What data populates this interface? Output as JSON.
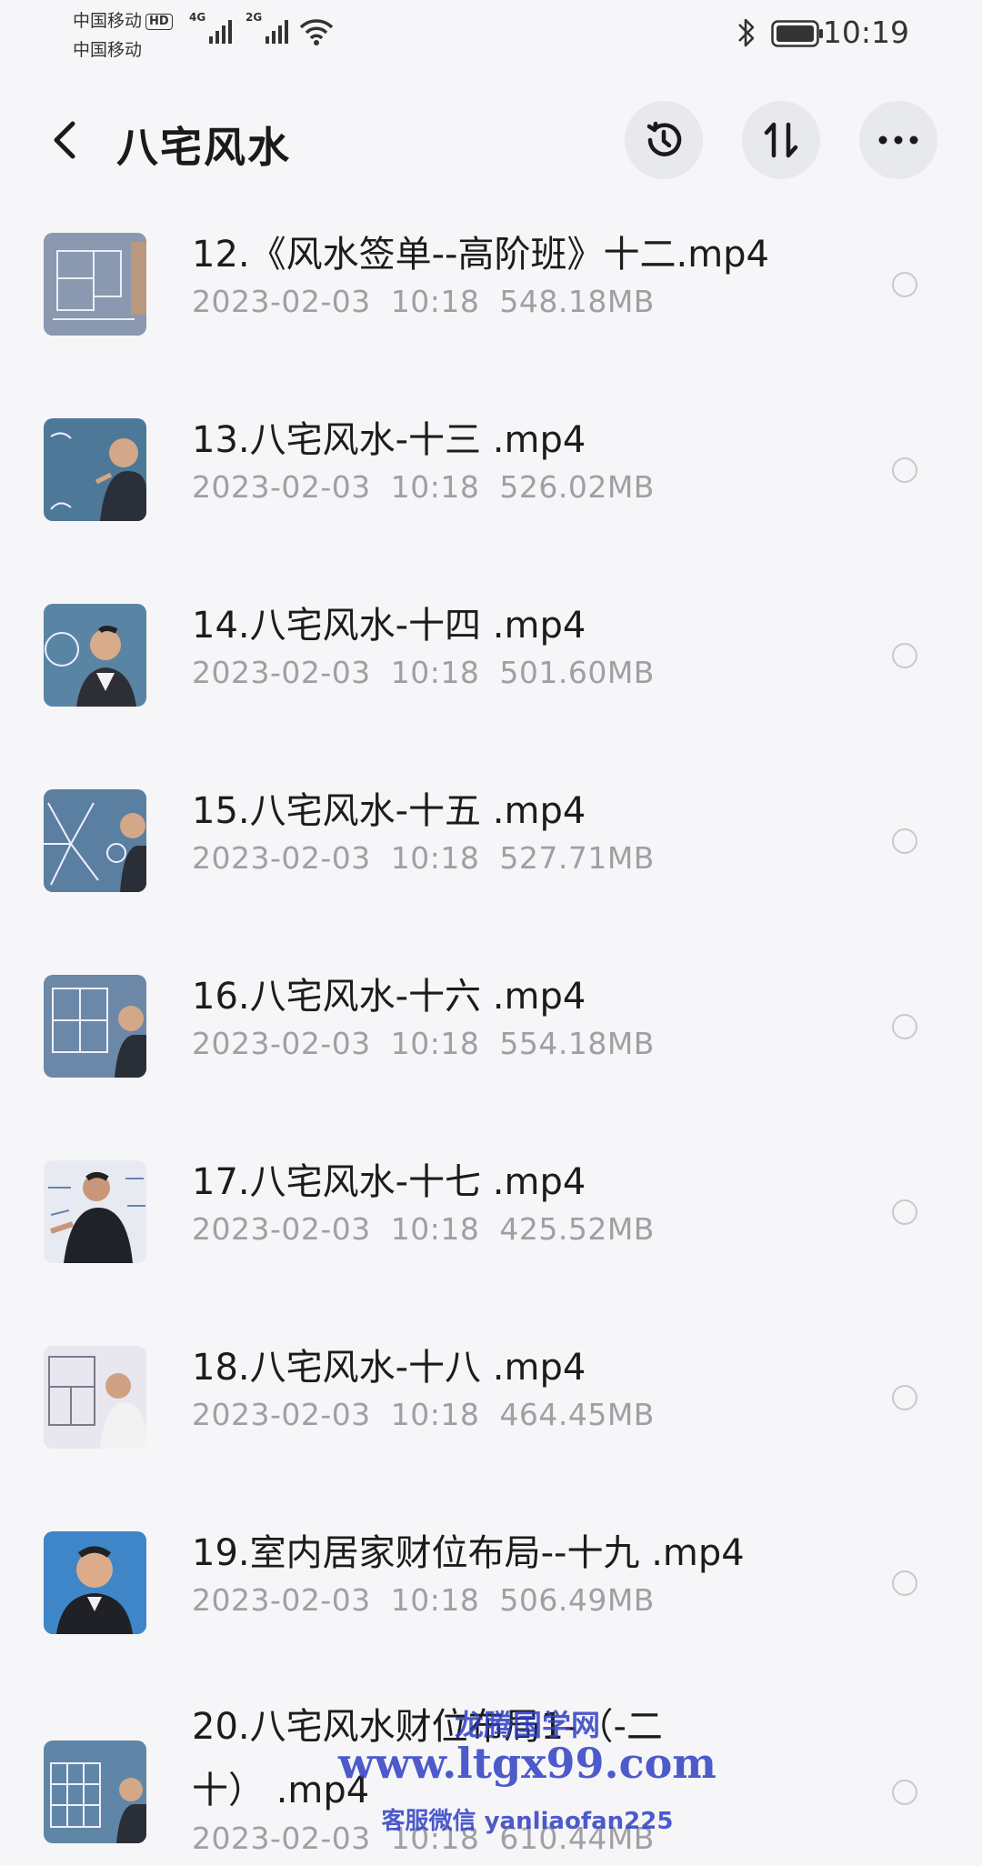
{
  "status_bar": {
    "carrier1": "中国移动",
    "carrier1_badge": "HD",
    "carrier2": "中国移动",
    "signal1_label": "4G",
    "signal2_label": "2G",
    "time": "10:19",
    "icons": [
      "signal-icon",
      "wifi-icon",
      "bluetooth-icon",
      "battery-icon"
    ]
  },
  "header": {
    "title": "八宅风水",
    "buttons": [
      "back-icon",
      "history-icon",
      "sort-icon",
      "more-icon"
    ]
  },
  "files": [
    {
      "name": "12.《风水签单--高阶班》十二.mp4",
      "date": "2023-02-03",
      "time": "10:18",
      "size": "548.18MB",
      "thumb": "floorplan-whiteboard"
    },
    {
      "name": "13.八宅风水-十三 .mp4",
      "date": "2023-02-03",
      "time": "10:18",
      "size": "526.02MB",
      "thumb": "teacher-at-board"
    },
    {
      "name": "14.八宅风水-十四 .mp4",
      "date": "2023-02-03",
      "time": "10:18",
      "size": "501.60MB",
      "thumb": "teacher-facing"
    },
    {
      "name": "15.八宅风水-十五 .mp4",
      "date": "2023-02-03",
      "time": "10:18",
      "size": "527.71MB",
      "thumb": "compass-diagram"
    },
    {
      "name": "16.八宅风水-十六 .mp4",
      "date": "2023-02-03",
      "time": "10:18",
      "size": "554.18MB",
      "thumb": "floorplan-board"
    },
    {
      "name": "17.八宅风水-十七 .mp4",
      "date": "2023-02-03",
      "time": "10:18",
      "size": "425.52MB",
      "thumb": "teacher-pointing"
    },
    {
      "name": "18.八宅风水-十八 .mp4",
      "date": "2023-02-03",
      "time": "10:18",
      "size": "464.45MB",
      "thumb": "floorplan-light"
    },
    {
      "name": "19.室内居家财位布局--十九 .mp4",
      "date": "2023-02-03",
      "time": "10:18",
      "size": "506.49MB",
      "thumb": "teacher-closeup"
    },
    {
      "name": "20.八宅风水财位布局1-（-二十） .mp4",
      "date": "2023-02-03",
      "time": "10:18",
      "size": "610.44MB",
      "thumb": "grid-board"
    }
  ],
  "watermark": {
    "line1": "龙腾国学网",
    "line2": "www.ltgx99.com",
    "line3": "客服微信 yanliaofan225"
  },
  "colors": {
    "background": "#f6f6f8",
    "meta_text": "#a0a0a3",
    "header_button_bg": "#e8e9ec",
    "watermark": "#2f3fc4"
  }
}
